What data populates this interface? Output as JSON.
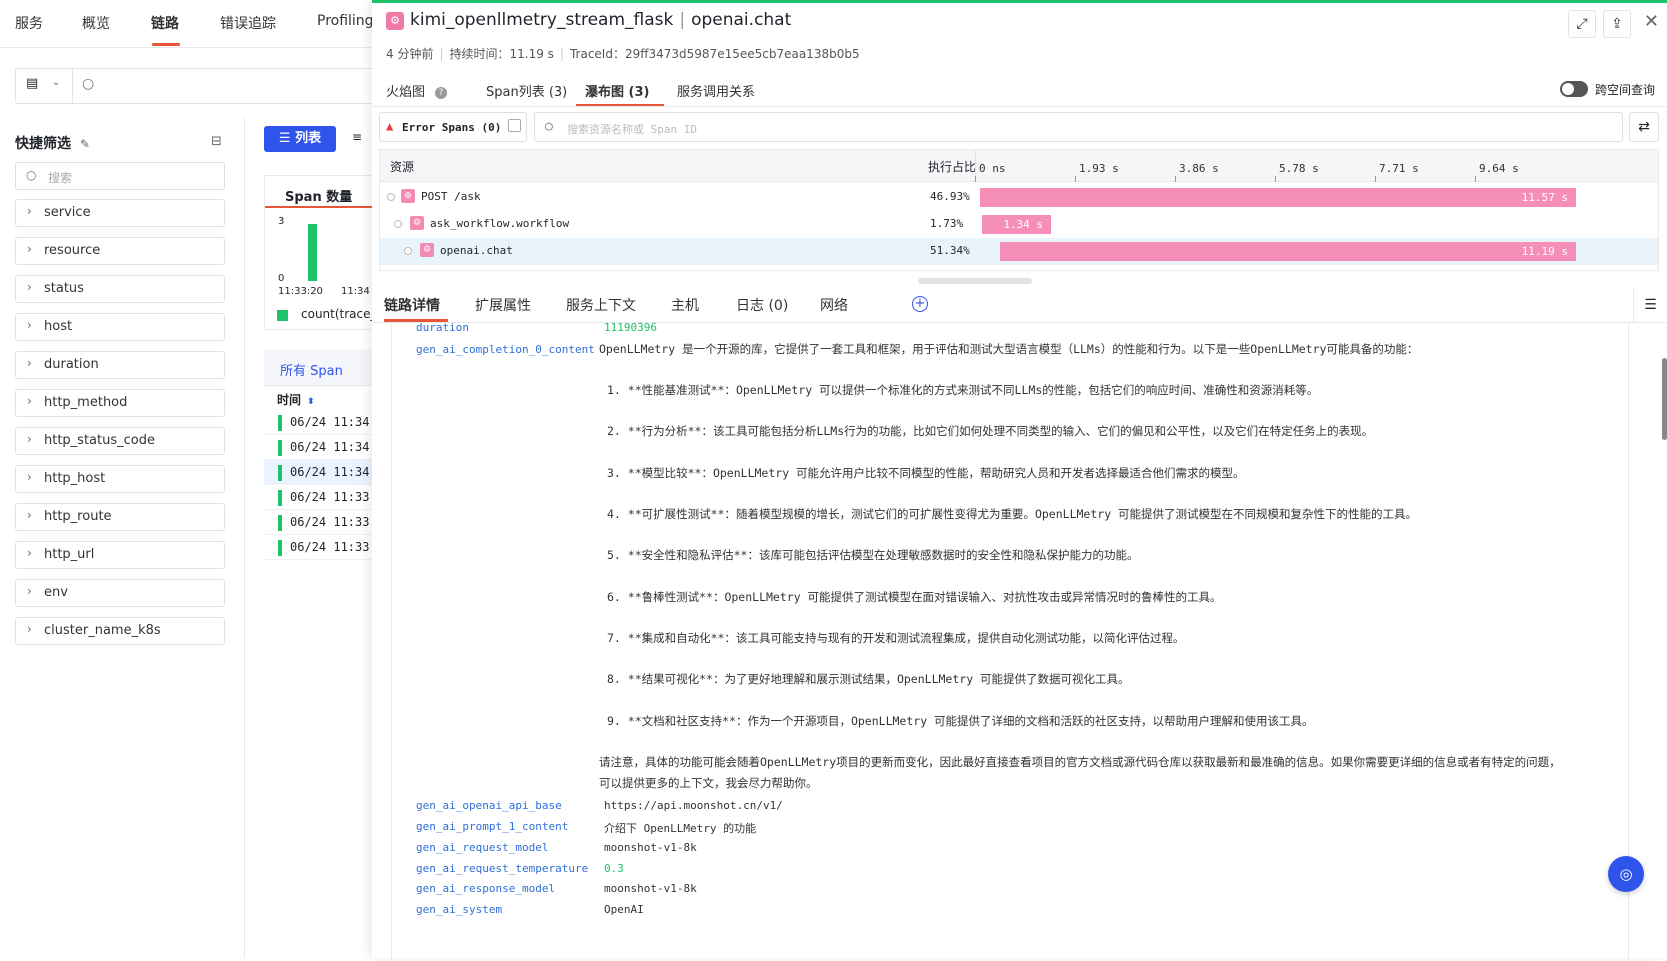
{
  "topnav": {
    "items": [
      "服务",
      "概览",
      "链路",
      "错误追踪",
      "Profiling"
    ]
  },
  "filters": {
    "title": "快捷筛选",
    "search_placeholder": "搜索",
    "facets": [
      "service",
      "resource",
      "status",
      "host",
      "duration",
      "http_method",
      "http_status_code",
      "http_host",
      "http_route",
      "http_url",
      "env",
      "cluster_name_k8s"
    ]
  },
  "list": {
    "button_label": "列表",
    "card_title": "Span 数量",
    "chart_y_max": "3",
    "chart_y_min": "0",
    "chart_x_1": "11:33:20",
    "chart_x_2": "11:34",
    "legend": "count(trace_",
    "tab_all": "所有 Span",
    "time_header": "时间",
    "rows": [
      "06/24 11:34:",
      "06/24 11:34:",
      "06/24 11:34:",
      "06/24 11:33:",
      "06/24 11:33:",
      "06/24 11:33:"
    ]
  },
  "drawer": {
    "service": "kimi_openllmetry_stream_flask",
    "span_name": "openai.chat",
    "time_ago": "4 分钟前",
    "duration": "持续时间：11.19 s",
    "trace_id": "TraceId：29ff3473d5987e15ee5cb7eaa138b0b5",
    "view_tabs": [
      "火焰图",
      "Span列表 (3)",
      "瀑布图 (3)",
      "服务调用关系"
    ],
    "cross_space": "跨空间查询",
    "error_spans": "Error Spans (0)",
    "search_placeholder": "搜索资源名称或 Span ID",
    "waterfall": {
      "col_resource": "资源",
      "col_pct": "执行占比",
      "ticks": [
        "0 ns",
        "1.93 s",
        "3.86 s",
        "5.78 s",
        "7.71 s",
        "9.64 s"
      ],
      "rows": [
        {
          "name": "POST /ask",
          "pct": "46.93%",
          "dur": "11.57 s",
          "start": 0.0,
          "len": 11.57
        },
        {
          "name": "ask_workflow.workflow",
          "pct": "1.73%",
          "dur": "1.34 s",
          "start": 0.04,
          "len": 1.34
        },
        {
          "name": "openai.chat",
          "pct": "51.34%",
          "dur": "11.19 s",
          "start": 0.38,
          "len": 11.19
        }
      ],
      "axis_max_s": 11.57
    },
    "detail_tabs": [
      "链路详情",
      "扩展属性",
      "服务上下文",
      "主机",
      "日志 (0)",
      "网络"
    ],
    "attrs": {
      "duration_key": "duration",
      "duration_val": "11190396",
      "completion_key": "gen_ai_completion_0_content",
      "completion_intro": "OpenLLMetry 是一个开源的库，它提供了一套工具和框架，用于评估和测试大型语言模型（LLMs）的性能和行为。以下是一些OpenLLMetry可能具备的功能：",
      "completion_items": [
        "1. **性能基准测试**：OpenLLMetry 可以提供一个标准化的方式来测试不同LLMs的性能，包括它们的响应时间、准确性和资源消耗等。",
        "2. **行为分析**：该工具可能包括分析LLMs行为的功能，比如它们如何处理不同类型的输入、它们的偏见和公平性，以及它们在特定任务上的表现。",
        "3. **模型比较**：OpenLLMetry 可能允许用户比较不同模型的性能，帮助研究人员和开发者选择最适合他们需求的模型。",
        "4. **可扩展性测试**：随着模型规模的增长，测试它们的可扩展性变得尤为重要。OpenLLMetry 可能提供了测试模型在不同规模和复杂性下的性能的工具。",
        "5. **安全性和隐私评估**：该库可能包括评估模型在处理敏感数据时的安全性和隐私保护能力的功能。",
        "6. **鲁棒性测试**：OpenLLMetry 可能提供了测试模型在面对错误输入、对抗性攻击或异常情况时的鲁棒性的工具。",
        "7. **集成和自动化**：该工具可能支持与现有的开发和测试流程集成，提供自动化测试功能，以简化评估过程。",
        "8. **结果可视化**：为了更好地理解和展示测试结果，OpenLLMetry 可能提供了数据可视化工具。",
        "9. **文档和社区支持**：作为一个开源项目，OpenLLMetry 可能提供了详细的文档和活跃的社区支持，以帮助用户理解和使用该工具。"
      ],
      "completion_outro_1": "请注意，具体的功能可能会随着OpenLLMetry项目的更新而变化，因此最好直接查看项目的官方文档或源代码仓库以获取最新和最准确的信息。如果你需要更详细的信息或者有特定的问题，",
      "completion_outro_2": "可以提供更多的上下文，我会尽力帮助你。",
      "pairs": [
        {
          "key": "gen_ai_openai_api_base",
          "val": "https://api.moonshot.cn/v1/"
        },
        {
          "key": "gen_ai_prompt_1_content",
          "val": "介绍下 OpenLLMetry 的功能"
        },
        {
          "key": "gen_ai_request_model",
          "val": "moonshot-v1-8k"
        },
        {
          "key": "gen_ai_request_temperature",
          "val": "0.3"
        },
        {
          "key": "gen_ai_response_model",
          "val": "moonshot-v1-8k"
        },
        {
          "key": "gen_ai_system",
          "val": "OpenAI"
        }
      ]
    }
  },
  "colors": {
    "accent": "#e8563a",
    "brand": "#2f54eb",
    "bar": "#f68fb8",
    "success": "#1ec26b"
  }
}
